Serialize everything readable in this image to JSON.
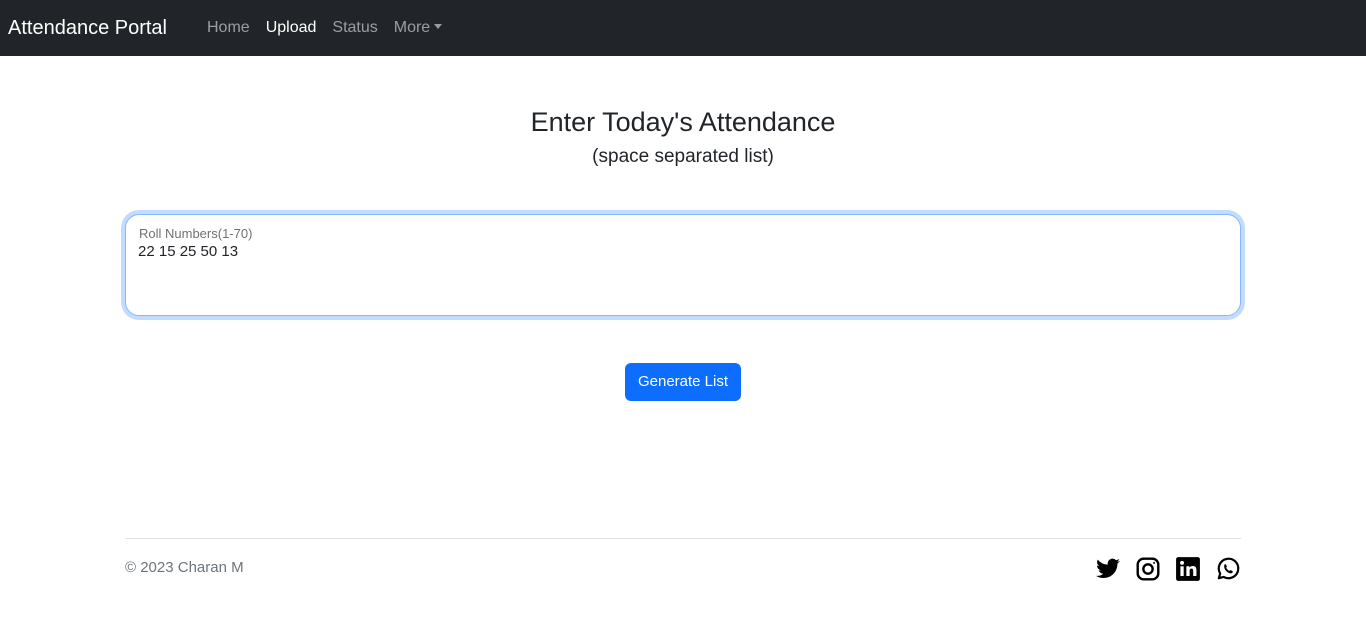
{
  "navbar": {
    "brand": "Attendance Portal",
    "links": [
      {
        "label": "Home"
      },
      {
        "label": "Upload"
      },
      {
        "label": "Status"
      },
      {
        "label": "More"
      }
    ]
  },
  "main": {
    "title": "Enter Today's Attendance",
    "subtitle": "(space separated list)",
    "input": {
      "label": "Roll Numbers(1-70)",
      "value": "22 15 25 50 13"
    },
    "button_label": "Generate List"
  },
  "footer": {
    "copyright": "© 2023 Charan M",
    "socials": [
      "twitter-icon",
      "instagram-icon",
      "linkedin-icon",
      "whatsapp-icon"
    ]
  },
  "colors": {
    "navbar_bg": "#212529",
    "primary": "#0d6efd"
  }
}
